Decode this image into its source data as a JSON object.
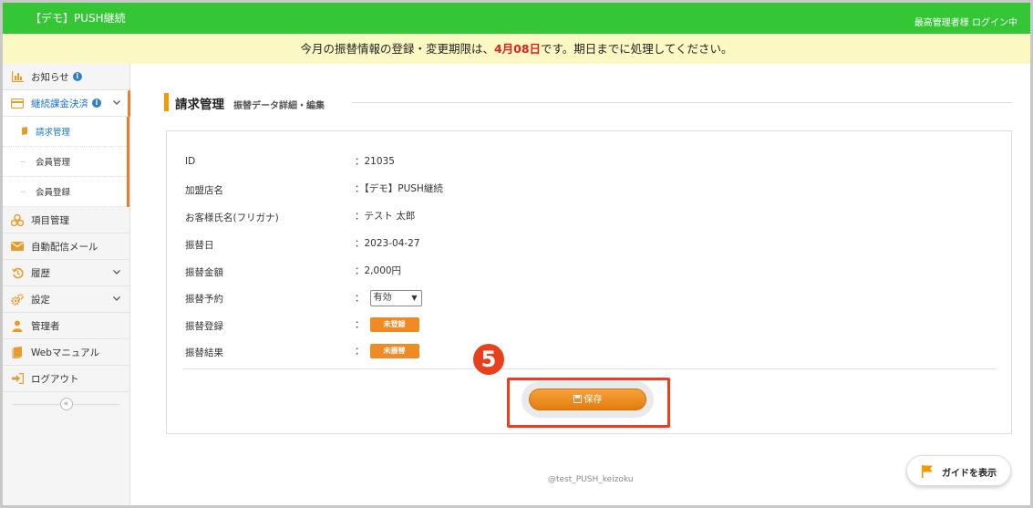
{
  "header": {
    "brand": "【デモ】PUSH継続",
    "login_status": "最高管理者様 ログイン中"
  },
  "notice": {
    "prefix": "今月の振替情報の登録・変更期限は、",
    "deadline": "4月08日",
    "suffix": "です。期日までに処理してください。"
  },
  "sidebar": {
    "items": [
      {
        "label": "お知らせ",
        "icon": "chart-icon"
      },
      {
        "label": "継続課金決済",
        "icon": "credit-card-icon"
      },
      {
        "label": "項目管理",
        "icon": "cubes-icon"
      },
      {
        "label": "自動配信メール",
        "icon": "envelope-icon"
      },
      {
        "label": "履歴",
        "icon": "history-icon"
      },
      {
        "label": "設定",
        "icon": "gears-icon"
      },
      {
        "label": "管理者",
        "icon": "user-icon"
      },
      {
        "label": "Webマニュアル",
        "icon": "book-icon"
      },
      {
        "label": "ログアウト",
        "icon": "logout-icon"
      }
    ],
    "sub_items": [
      {
        "label": "請求管理"
      },
      {
        "label": "会員管理"
      },
      {
        "label": "会員登録"
      }
    ],
    "collapse_symbol": "«"
  },
  "page": {
    "title": "請求管理",
    "subtitle": "振替データ詳細・編集"
  },
  "detail": {
    "rows": [
      {
        "label": "ID",
        "value": "：21035"
      },
      {
        "label": "加盟店名",
        "value": "：【デモ】PUSH継続"
      },
      {
        "label": "お客様氏名(フリガナ)",
        "value": "：テスト 太郎"
      },
      {
        "label": "振替日",
        "value": "：2023-04-27"
      },
      {
        "label": "振替金額",
        "value": "：2,000円"
      },
      {
        "label": "振替予約",
        "value": "："
      },
      {
        "label": "振替登録",
        "value": "："
      },
      {
        "label": "振替結果",
        "value": "："
      }
    ],
    "reservation_selected": "有効",
    "registration_status": "未登録",
    "result_status": "未振替"
  },
  "actions": {
    "save_label": "保存",
    "step_number": "5"
  },
  "footer": {
    "copyright": "@test_PUSH_keizoku",
    "guide_label": "ガイドを表示"
  },
  "colors": {
    "topbar": "#35c636",
    "notice_bg": "#fbf9c3",
    "accent_orange": "#f39800",
    "highlight_red": "#e8401c",
    "link_blue": "#1a73c8"
  }
}
